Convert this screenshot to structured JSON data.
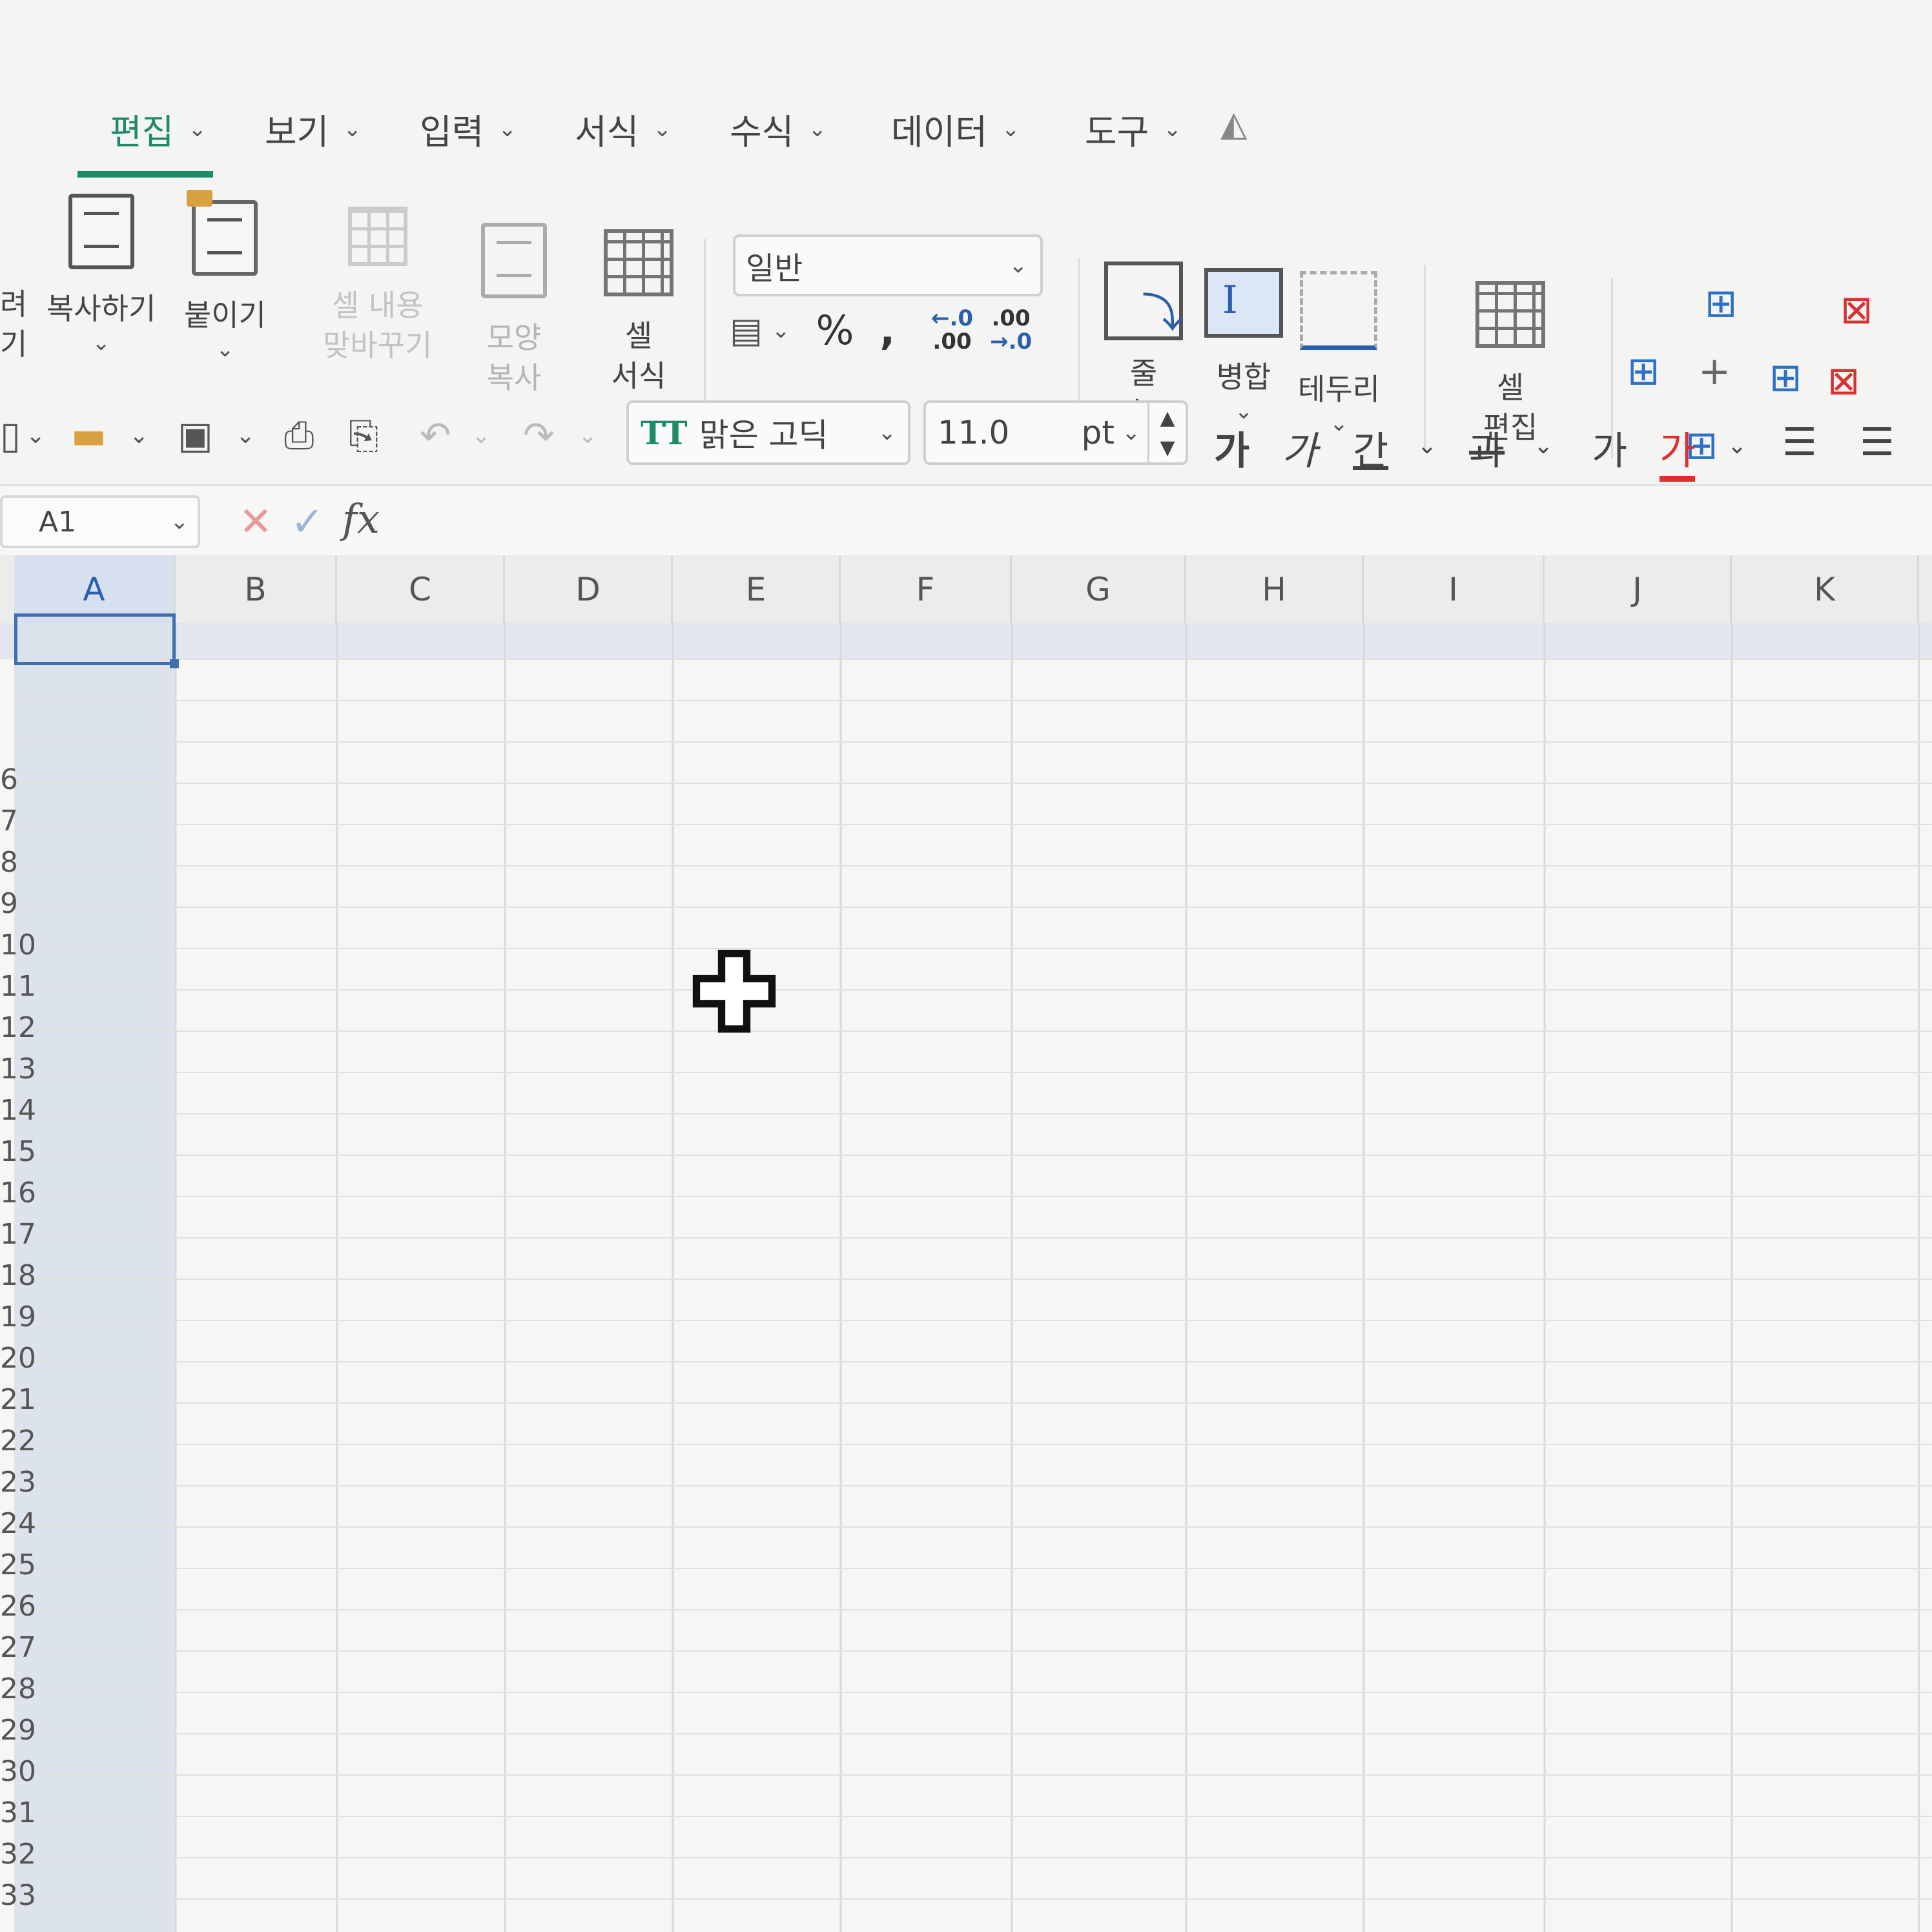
{
  "menu": {
    "tabs": [
      {
        "label": "편집",
        "active": true
      },
      {
        "label": "보기",
        "active": false
      },
      {
        "label": "입력",
        "active": false
      },
      {
        "label": "서식",
        "active": false
      },
      {
        "label": "수식",
        "active": false
      },
      {
        "label": "데이터",
        "active": false
      },
      {
        "label": "도구",
        "active": false
      }
    ],
    "chevron": "⌄"
  },
  "ribbon": {
    "partial_left_1": "려",
    "partial_left_2": "기",
    "copy": "복사하기",
    "paste": "붙이기",
    "swap_line1": "셀 내용",
    "swap_line2": "맞바꾸기",
    "format_painter_line1": "모양",
    "format_painter_line2": "복사",
    "cell_format_line1": "셀",
    "cell_format_line2": "서식",
    "number_format": "일반",
    "percent": "%",
    "comma": ",",
    "dec_increase_top": "←.0",
    "dec_increase_bottom": ".00",
    "dec_decrease_top": ".00",
    "dec_decrease_bottom": "→.0",
    "wrap_line1": "줄",
    "wrap_line2": "바꿈",
    "merge": "병합",
    "border": "테두리",
    "cell_edit_line1": "셀",
    "cell_edit_line2": "편집"
  },
  "toolbar": {
    "font_name": "맑은 고딕",
    "font_icon": "TT",
    "font_size": "11.0",
    "font_unit": "pt",
    "bold": "가",
    "italic": "가",
    "underline": "간",
    "strike": "과",
    "plain": "가",
    "font_color": "가",
    "font_color_hex": "#d93030"
  },
  "formula_bar": {
    "name_box": "A1",
    "fx": "fx",
    "content": ""
  },
  "grid": {
    "columns": [
      "A",
      "B",
      "C",
      "D",
      "E",
      "F",
      "G",
      "H",
      "I",
      "J",
      "K"
    ],
    "selected_column": "A",
    "rows": [
      "6",
      "7",
      "8",
      "9",
      "10",
      "11",
      "12",
      "13",
      "14",
      "15",
      "16",
      "17",
      "18",
      "19",
      "20",
      "21",
      "22",
      "23",
      "24",
      "25",
      "26",
      "27",
      "28",
      "29",
      "30",
      "31",
      "32",
      "33"
    ],
    "selected_cell": "A1"
  },
  "colors": {
    "accent": "#1f8a6a",
    "selection": "#3f6fb0"
  }
}
